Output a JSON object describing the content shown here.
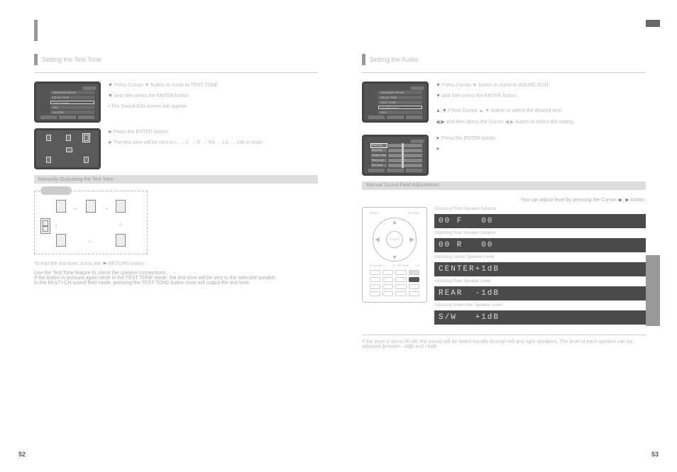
{
  "page_left_num": "52",
  "page_right_num": "53",
  "left": {
    "heading": "Setting the Test Tone",
    "screen1_menu": [
      "SPEAKER SETUP",
      "DELAY TIME",
      "TEST TONE",
      "DRC",
      "AV-SYNC"
    ],
    "step1": "Press Cursor ▼ button to move to TEST TONE",
    "step2": "and then press the ENTER button.",
    "step2b": "The Sound Edit screen will appear.",
    "ptr1": "Press the ENTER button.",
    "ptr2": "The test tone will be sent to L → C → R → RS → LS → SW in order.",
    "grey": "Manually Outputting the Test Tone",
    "hint_note_pre": "To end the test tone, press the ",
    "hint_note_btn": "➤",
    "hint_note_post": " RETURN button.",
    "l1": "Use the Test Tone feature to check the speaker connections.",
    "l2": "If the button is pressed again while in the TEST TONE mode, the test tone will be sent to the selected speaker.",
    "l3": "In the MULTI-CH sound field mode, pressing the TEST TONE button once will output the test tone."
  },
  "right": {
    "heading": "Setting the Audio",
    "screen1_menu": [
      "SPEAKER SETUP",
      "DELAY TIME",
      "TEST TONE",
      "SOUND EDIT",
      "DRC",
      "AV-SYNC"
    ],
    "step1": "Press Cursor ▼ button to move to SOUND EDIT",
    "step2": "and then press the ENTER button.",
    "step3a": "Press Cursor ▲,▼ button to select the desired item",
    "step3b": "and then press the Cursor ◀,▶ button to select the setting.",
    "ptr1": "Press the ENTER button.",
    "ptr2": "",
    "levels": [
      "Front Bal.",
      "Rear Bal.",
      "Center Level",
      "Rear Level",
      "SW Level"
    ],
    "grey": "Manual Sound-Field Adjustments",
    "adj_pre": "You can adjust level by pressing the Cursor ",
    "adj_arrows": "◀ , ▶",
    "adj_post": " button.",
    "displays": [
      "00 F   00",
      "00 R   00",
      "CENTER+1dB",
      "REAR  -1dB",
      "S/W   +1dB"
    ],
    "d_lbl1": "Adjusting Front Speaker Balance",
    "d_lbl2": "Adjusting Rear Speaker Balance",
    "d_lbl3": "Adjusting Center Speaker Level",
    "d_lbl4": "Adjusting Rear Speaker Level",
    "d_lbl5": "Adjusting Subwoofer Speaker Level",
    "foot": "If the level is set to 00 dB, the sound will be heard equally through left and right speakers. The level of each speaker can be adjusted between –6dB and +6dB."
  },
  "remote": {
    "top_l": "MENU",
    "top_r": "RETURN",
    "center": "ENTER",
    "row_l": "EZ SOUND X",
    "row_c": "CH / RETURN",
    "row_r": "CH"
  }
}
